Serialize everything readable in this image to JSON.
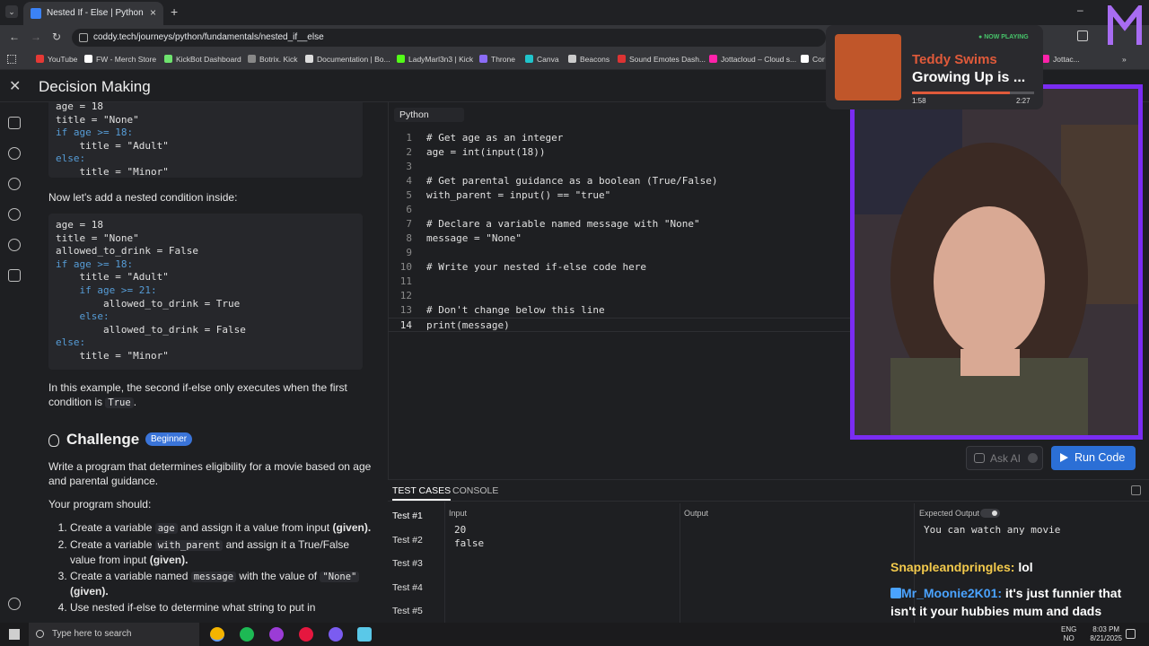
{
  "browser": {
    "tab_title": "Nested If - Else | Python",
    "url": "coddy.tech/journeys/python/fundamentals/nested_if__else",
    "bookmarks": [
      "YouTube",
      "FW - Merch Store",
      "KickBot Dashboard",
      "Botrix. Kick",
      "Documentation | Bo...",
      "LadyMarl3n3 | Kick",
      "Throne",
      "Canva",
      "Beacons",
      "Sound Emotes Dash...",
      "Jottacloud – Cloud s...",
      "Cor",
      "Jottac..."
    ]
  },
  "app": {
    "title": "Decision Making"
  },
  "lesson": {
    "code1": [
      "age = 18",
      "title = \"None\"",
      "if age >= 18:",
      "    title = \"Adult\"",
      "else:",
      "    title = \"Minor\""
    ],
    "para1": "Now let's add a nested condition inside:",
    "code2": [
      "age = 18",
      "title = \"None\"",
      "allowed_to_drink = False",
      "if age >= 18:",
      "    title = \"Adult\"",
      "    if age >= 21:",
      "        allowed_to_drink = True",
      "    else:",
      "        allowed_to_drink = False",
      "else:",
      "    title = \"Minor\""
    ],
    "para2a": "In this example, the second if-else only executes when the first condition is",
    "para2_code": "True",
    "para2b": ".",
    "challenge_title": "Challenge",
    "challenge_badge": "Beginner",
    "challenge_desc": "Write a program that determines eligibility for a movie based on age and parental guidance.",
    "should": "Your program should:",
    "req1_a": "Create a variable",
    "req1_code": "age",
    "req1_b": "and assign it a value from input",
    "req1_c": "(given).",
    "req2_a": "Create a variable",
    "req2_code": "with_parent",
    "req2_b": "and assign it a True/False value from input",
    "req2_c": "(given).",
    "req3_a": "Create a variable named",
    "req3_code": "message",
    "req3_b": "with the value of",
    "req3_code2": "\"None\"",
    "req3_c": "(given).",
    "req4": "Use nested if-else to determine what string to put in"
  },
  "editor": {
    "tab": "Python",
    "lines": [
      {
        "n": "1",
        "text": "# Get age as an integer"
      },
      {
        "n": "2",
        "text": "age = int(input(18))"
      },
      {
        "n": "3",
        "text": ""
      },
      {
        "n": "4",
        "text": "# Get parental guidance as a boolean (True/False)"
      },
      {
        "n": "5",
        "text": "with_parent = input() == \"true\""
      },
      {
        "n": "6",
        "text": ""
      },
      {
        "n": "7",
        "text": "# Declare a variable named message with \"None\""
      },
      {
        "n": "8",
        "text": "message = \"None\""
      },
      {
        "n": "9",
        "text": ""
      },
      {
        "n": "10",
        "text": "# Write your nested if-else code here"
      },
      {
        "n": "11",
        "text": ""
      },
      {
        "n": "12",
        "text": ""
      },
      {
        "n": "13",
        "text": "# Don't change below this line"
      },
      {
        "n": "14",
        "text": "print(message)"
      }
    ]
  },
  "buttons": {
    "ask_ai": "Ask AI",
    "run_code": "Run Code"
  },
  "tests": {
    "tab_cases": "TEST CASES",
    "tab_console": "CONSOLE",
    "items": [
      "Test #1",
      "Test #2",
      "Test #3",
      "Test #4",
      "Test #5"
    ],
    "input_label": "Input",
    "input_value": "20\nfalse",
    "output_label": "Output",
    "expected_label": "Expected Output",
    "expected_value": "You can watch any movie"
  },
  "now_playing": {
    "badge": "NOW PLAYING",
    "artist": "Teddy Swims",
    "song": "Growing Up is ...",
    "elapsed": "1:58",
    "duration": "2:27",
    "progress": 0.8
  },
  "chat": [
    {
      "user": "Snappleandpringles:",
      "msg": "lol"
    },
    {
      "user": "Mr_Moonie2K01:",
      "msg": "it's just funnier that isn't it your hubbies mum and dads place? 😄"
    }
  ],
  "taskbar": {
    "search_placeholder": "Type here to search",
    "lang": "ENG",
    "region": "NO",
    "time": "8:03 PM",
    "date": "8/21/2025"
  },
  "colors": {
    "accent": "#2b6fd6",
    "cam_border": "#7a2cf2"
  }
}
